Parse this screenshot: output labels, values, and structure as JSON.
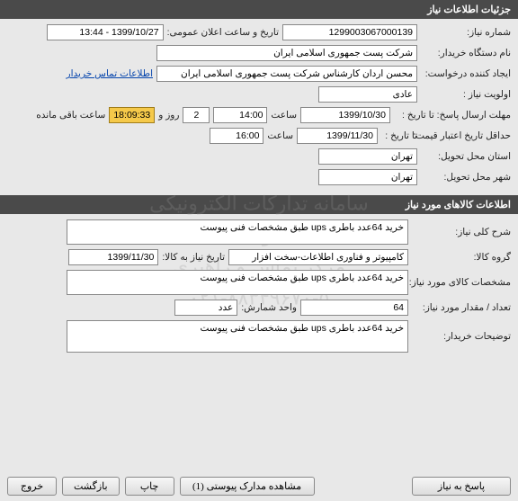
{
  "sections": {
    "need_info": "جزئیات اطلاعات نیاز",
    "goods_info": "اطلاعات کالاهای مورد نیاز"
  },
  "labels": {
    "need_number": "شماره نیاز:",
    "announce_datetime": "تاریخ و ساعت اعلان عمومی:",
    "buyer_org": "نام دستگاه خریدار:",
    "creator": "ایجاد کننده درخواست:",
    "contact_link": "اطلاعات تماس خریدار",
    "priority": "اولویت نیاز :",
    "deadline": "مهلت ارسال پاسخ:  تا تاریخ :",
    "time_lbl": "ساعت",
    "day_and": "روز و",
    "remaining": "ساعت باقی مانده",
    "min_valid": "حداقل تاریخ اعتبار قیمت:",
    "to_date": "تا تاریخ :",
    "delivery_state": "استان محل تحویل:",
    "delivery_city": "شهر محل تحویل:",
    "general_desc": "شرح کلی نیاز:",
    "goods_group": "گروه کالا:",
    "goods_date": "تاریخ نیاز به کالا:",
    "goods_spec": "مشخصات کالای مورد نیاز:",
    "qty": "تعداد / مقدار مورد نیاز:",
    "unit": "واحد شمارش:",
    "buyer_notes": "توضیحات خریدار:"
  },
  "values": {
    "need_number": "1299003067000139",
    "announce_datetime": "1399/10/27 - 13:44",
    "buyer_org": "شرکت پست جمهوری اسلامی ایران",
    "creator": "محسن اردان کارشناس شرکت پست جمهوری اسلامی ایران",
    "priority": "عادی",
    "deadline_date": "1399/10/30",
    "deadline_time": "14:00",
    "days_left": "2",
    "time_left": "18:09:33",
    "valid_date": "1399/11/30",
    "valid_time": "16:00",
    "state": "تهران",
    "city": "تهران",
    "general_desc": "خرید 64عدد باطری ups طبق مشخصات فنی پیوست",
    "goods_group": "کامپیوتر و فناوری اطلاعات-سخت افزار",
    "goods_date": "1399/11/30",
    "goods_spec": "خرید 64عدد باطری ups طبق مشخصات فنی پیوست",
    "qty": "64",
    "unit": "عدد",
    "buyer_notes": "خرید 64عدد باطری ups طبق مشخصات فنی پیوست"
  },
  "buttons": {
    "exit": "خروج",
    "back": "بازگشت",
    "print": "چاپ",
    "attachments": "مشاهده مدارک پیوستی  (1)",
    "respond": "پاسخ به نیاز"
  },
  "watermark": {
    "line1": "سامانه تدارکات الکترونیکی دولت",
    "line2": "مرکز تماس و راهبری",
    "line3": "۰۲۱-۸۸۳۴۹۶۷۰-۵"
  }
}
